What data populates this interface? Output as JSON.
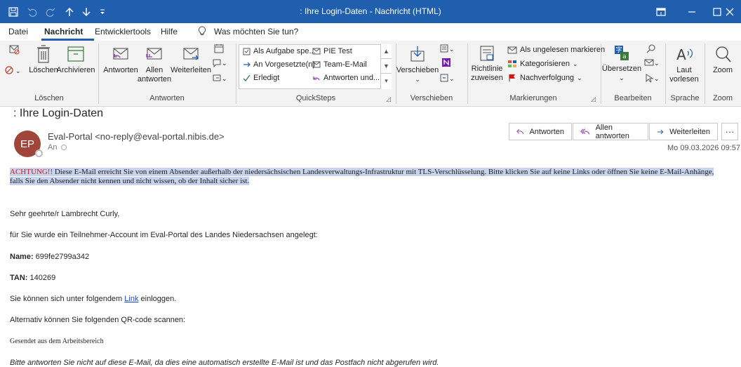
{
  "window": {
    "title": ": Ihre Login-Daten  -  Nachricht (HTML)",
    "quick_access": [
      "save-icon",
      "undo-icon",
      "redo-icon",
      "arrow-up-icon",
      "arrow-down-icon",
      "customize-icon"
    ],
    "controls": [
      "restore-ribbon-icon",
      "minimize-icon",
      "maximize-icon",
      "close-icon"
    ]
  },
  "menu": {
    "items": [
      "Datei",
      "Nachricht",
      "Entwicklertools",
      "Hilfe"
    ],
    "tell_me": "Was möchten Sie tun?"
  },
  "ribbon": {
    "loeschen": {
      "label": "Löschen",
      "delete": "Löschen",
      "archive": "Archivieren"
    },
    "antworten": {
      "label": "Antworten",
      "reply": "Antworten",
      "reply_all_1": "Allen",
      "reply_all_2": "antworten",
      "forward": "Weiterleiten"
    },
    "quicksteps": {
      "label": "QuickSteps",
      "items": [
        "Als Aufgabe spe...",
        "An Vorgesetzte(n)",
        "Erledigt",
        "PIE Test",
        "Team-E-Mail",
        "Antworten und..."
      ]
    },
    "verschieben": {
      "label": "Verschieben",
      "move": "Verschieben"
    },
    "markierungen": {
      "label": "Markierungen",
      "policy_1": "Richtlinie",
      "policy_2": "zuweisen",
      "unread": "Als ungelesen markieren",
      "categorize": "Kategorisieren",
      "followup": "Nachverfolgung"
    },
    "bearbeiten": {
      "label": "Bearbeiten",
      "translate": "Übersetzen"
    },
    "sprache": {
      "label": "Sprache",
      "read_1": "Laut",
      "read_2": "vorlesen"
    },
    "zoom": {
      "label": "Zoom",
      "zoom": "Zoom"
    }
  },
  "message": {
    "subject": ": Ihre Login-Daten",
    "avatar_initials": "EP",
    "sender": "Eval-Portal <no-reply@eval-portal.nibis.de>",
    "to_label": "An",
    "date": "Mo 09.03.2026 09:57",
    "actions": {
      "reply": "Antworten",
      "reply_all": "Allen antworten",
      "forward": "Weiterleiten"
    },
    "warning": {
      "prefix": "ACHTUNG!!",
      "text": " Diese E-Mail erreicht Sie von einem Absender außerhalb der niedersächsischen Landesverwaltungs-Infrastruktur mit TLS-Verschlüsselung. Bitte klicken Sie auf keine Links oder öffnen Sie keine E-Mail-Anhänge, falls Sie den Absender nicht kennen und nicht wissen, ob der Inhalt sicher ist."
    },
    "body": {
      "greeting": "Sehr geehrte/r Lambrecht Curly,",
      "intro": "für Sie wurde ein Teilnehmer-Account im Eval-Portal des Landes Niedersachsen angelegt:",
      "name_label": "Name:",
      "name_value": " 699fe2799a342",
      "tan_label": "TAN:",
      "tan_value": " 140269",
      "link_pre": "Sie können sich unter folgendem ",
      "link_text": "Link",
      "link_post": " einloggen.",
      "qr": "Alternativ können Sie folgenden QR-code scannen:",
      "sent_from": "Gesendet aus dem Arbeitsbereich",
      "footer": "Bitte antworten Sie nicht auf diese E-Mail, da dies eine automatisch erstellte E-Mail ist und das Postfach nicht abgerufen wird."
    }
  },
  "colors": {
    "titlebar": "#1f5fae",
    "avatar": "#a0453a",
    "warning_highlight": "#c8d4ec",
    "warning_red": "#d01818",
    "link": "#1a47c9"
  }
}
